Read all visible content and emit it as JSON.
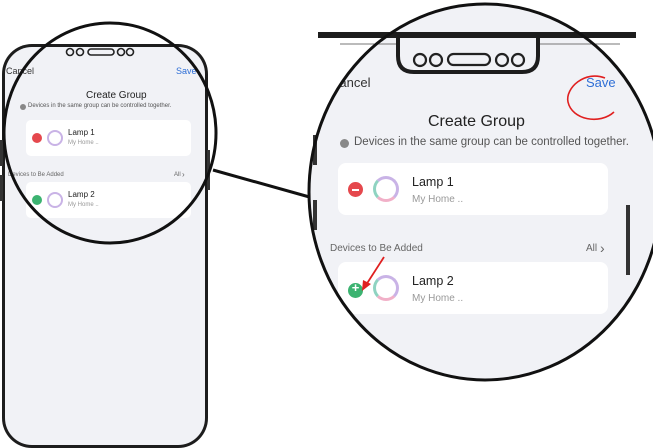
{
  "nav": {
    "cancel": "Cancel",
    "save": "Save"
  },
  "title": "Create Group",
  "info_text": "Devices in the same group can be controlled together.",
  "group_devices": [
    {
      "name": "Lamp 1",
      "location": "My Home ..",
      "action": "remove"
    }
  ],
  "add_section": {
    "label": "Devices to Be Added",
    "all_label": "All"
  },
  "devices_to_add": [
    {
      "name": "Lamp 2",
      "location": "My Home ..",
      "action": "add"
    }
  ],
  "colors": {
    "remove": "#e5484d",
    "add": "#3cb371",
    "accent": "#2f6fd6",
    "annotation": "#e02020",
    "background": "#f1f2f6"
  },
  "icons": [
    "info-icon",
    "remove-icon",
    "add-icon",
    "lamp-ring-icon",
    "chevron-right-icon"
  ]
}
